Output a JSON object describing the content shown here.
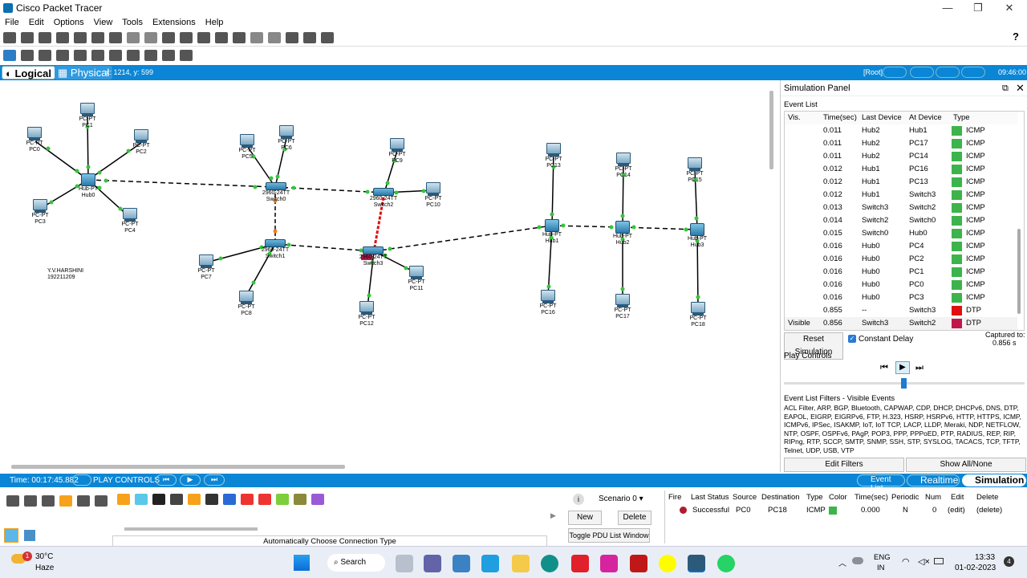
{
  "window": {
    "title": "Cisco Packet Tracer",
    "minimize": "—",
    "maximize": "❐",
    "close": "✕"
  },
  "menu": [
    "File",
    "Edit",
    "Options",
    "View",
    "Tools",
    "Extensions",
    "Help"
  ],
  "modebar": {
    "logical": "Logical",
    "physical": "Physical",
    "coords": "x: 1214, y: 599",
    "root": "[Root]",
    "clock": "09:46:00"
  },
  "canvas": {
    "note_name": "Y.V.HARSHINI",
    "note_id": "192211209",
    "devices": [
      {
        "name": "PC0",
        "type": "PC-PT",
        "kind": "pc"
      },
      {
        "name": "PC1",
        "type": "PC-PT",
        "kind": "pc"
      },
      {
        "name": "PC2",
        "type": "PC-PT",
        "kind": "pc"
      },
      {
        "name": "PC3",
        "type": "PC-PT",
        "kind": "pc"
      },
      {
        "name": "PC4",
        "type": "PC-PT",
        "kind": "pc"
      },
      {
        "name": "Hub0",
        "type": "Hub-PT",
        "kind": "hub"
      },
      {
        "name": "PC5",
        "type": "PC-PT",
        "kind": "pc"
      },
      {
        "name": "PC6",
        "type": "PC-PT",
        "kind": "pc"
      },
      {
        "name": "Switch0",
        "type": "2960-24TT",
        "kind": "switch"
      },
      {
        "name": "PC9",
        "type": "PC-PT",
        "kind": "pc"
      },
      {
        "name": "Switch2",
        "type": "2960-24TT",
        "kind": "switch"
      },
      {
        "name": "PC10",
        "type": "PC-PT",
        "kind": "pc"
      },
      {
        "name": "Switch1",
        "type": "2960-24TT",
        "kind": "switch"
      },
      {
        "name": "PC7",
        "type": "PC-PT",
        "kind": "pc"
      },
      {
        "name": "PC8",
        "type": "PC-PT",
        "kind": "pc"
      },
      {
        "name": "Switch3",
        "type": "2960-24TT",
        "kind": "switch"
      },
      {
        "name": "PC11",
        "type": "PC-PT",
        "kind": "pc"
      },
      {
        "name": "PC12",
        "type": "PC-PT",
        "kind": "pc"
      },
      {
        "name": "PC13",
        "type": "PC-PT",
        "kind": "pc"
      },
      {
        "name": "Hub1",
        "type": "Hub-PT",
        "kind": "hub"
      },
      {
        "name": "PC16",
        "type": "PC-PT",
        "kind": "pc"
      },
      {
        "name": "PC14",
        "type": "PC-PT",
        "kind": "pc"
      },
      {
        "name": "Hub2",
        "type": "Hub-PT",
        "kind": "hub"
      },
      {
        "name": "PC17",
        "type": "PC-PT",
        "kind": "pc"
      },
      {
        "name": "PC15",
        "type": "PC-PT",
        "kind": "pc"
      },
      {
        "name": "Hub3",
        "type": "Hub-PT",
        "kind": "hub"
      },
      {
        "name": "PC18",
        "type": "PC-PT",
        "kind": "pc"
      }
    ]
  },
  "sim": {
    "title": "Simulation Panel",
    "event_list": "Event List",
    "headers": [
      "Vis.",
      "Time(sec)",
      "Last Device",
      "At Device",
      "Type"
    ],
    "events": [
      {
        "vis": "",
        "time": "0.011",
        "last": "Hub2",
        "at": "Hub1",
        "type": "ICMP",
        "color": "#3cb44b"
      },
      {
        "vis": "",
        "time": "0.011",
        "last": "Hub2",
        "at": "PC17",
        "type": "ICMP",
        "color": "#3cb44b"
      },
      {
        "vis": "",
        "time": "0.011",
        "last": "Hub2",
        "at": "PC14",
        "type": "ICMP",
        "color": "#3cb44b"
      },
      {
        "vis": "",
        "time": "0.012",
        "last": "Hub1",
        "at": "PC16",
        "type": "ICMP",
        "color": "#3cb44b"
      },
      {
        "vis": "",
        "time": "0.012",
        "last": "Hub1",
        "at": "PC13",
        "type": "ICMP",
        "color": "#3cb44b"
      },
      {
        "vis": "",
        "time": "0.012",
        "last": "Hub1",
        "at": "Switch3",
        "type": "ICMP",
        "color": "#3cb44b"
      },
      {
        "vis": "",
        "time": "0.013",
        "last": "Switch3",
        "at": "Switch2",
        "type": "ICMP",
        "color": "#3cb44b"
      },
      {
        "vis": "",
        "time": "0.014",
        "last": "Switch2",
        "at": "Switch0",
        "type": "ICMP",
        "color": "#3cb44b"
      },
      {
        "vis": "",
        "time": "0.015",
        "last": "Switch0",
        "at": "Hub0",
        "type": "ICMP",
        "color": "#3cb44b"
      },
      {
        "vis": "",
        "time": "0.016",
        "last": "Hub0",
        "at": "PC4",
        "type": "ICMP",
        "color": "#3cb44b"
      },
      {
        "vis": "",
        "time": "0.016",
        "last": "Hub0",
        "at": "PC2",
        "type": "ICMP",
        "color": "#3cb44b"
      },
      {
        "vis": "",
        "time": "0.016",
        "last": "Hub0",
        "at": "PC1",
        "type": "ICMP",
        "color": "#3cb44b"
      },
      {
        "vis": "",
        "time": "0.016",
        "last": "Hub0",
        "at": "PC0",
        "type": "ICMP",
        "color": "#3cb44b"
      },
      {
        "vis": "",
        "time": "0.016",
        "last": "Hub0",
        "at": "PC3",
        "type": "ICMP",
        "color": "#3cb44b"
      },
      {
        "vis": "",
        "time": "0.855",
        "last": "--",
        "at": "Switch3",
        "type": "DTP",
        "color": "#e01010"
      },
      {
        "vis": "Visible",
        "time": "0.856",
        "last": "Switch3",
        "at": "Switch2",
        "type": "DTP",
        "color": "#c0184a"
      }
    ],
    "reset": "Reset Simulation",
    "constant_delay": "Constant Delay",
    "captured_label": "Captured to:",
    "captured_value": "0.856 s",
    "play_controls": "Play Controls",
    "filters_title": "Event List Filters - Visible Events",
    "filters_text": "ACL Filter, ARP, BGP, Bluetooth, CAPWAP, CDP, DHCP, DHCPv6, DNS, DTP, EAPOL, EIGRP, EIGRPv6, FTP, H.323, HSRP, HSRPv6, HTTP, HTTPS, ICMP, ICMPv6, IPSec, ISAKMP, IoT, IoT TCP, LACP, LLDP, Meraki, NDP, NETFLOW, NTP, OSPF, OSPFv6, PAgP, POP3, PPP, PPPoED, PTP, RADIUS, REP, RIP, RIPng, RTP, SCCP, SMTP, SNMP, SSH, STP, SYSLOG, TACACS, TCP, TFTP, Telnet, UDP, USB, VTP",
    "edit_filters": "Edit Filters",
    "show_all": "Show All/None"
  },
  "status": {
    "time": "Time: 00:17:45.882",
    "play_controls": "PLAY CONTROLS",
    "event_list": "Event List",
    "realtime": "Realtime",
    "simulation": "Simulation"
  },
  "bottom": {
    "connection_type": "Automatically Choose Connection Type",
    "scenario": "Scenario 0",
    "new": "New",
    "delete": "Delete",
    "toggle_pdu": "Toggle PDU List Window",
    "pdu_headers": [
      "Fire",
      "Last Status",
      "Source",
      "Destination",
      "Type",
      "Color",
      "Time(sec)",
      "Periodic",
      "Num",
      "Edit",
      "Delete"
    ],
    "pdu_row": {
      "status": "Successful",
      "source": "PC0",
      "destination": "PC18",
      "type": "ICMP",
      "time": "0.000",
      "periodic": "N",
      "num": "0",
      "edit": "(edit)",
      "delete": "(delete)"
    }
  },
  "taskbar": {
    "weather_temp": "30°C",
    "weather_desc": "Haze",
    "weather_badge": "1",
    "search": "Search",
    "lang1": "ENG",
    "lang2": "IN",
    "time": "13:33",
    "date": "01-02-2023",
    "notif": "4"
  }
}
